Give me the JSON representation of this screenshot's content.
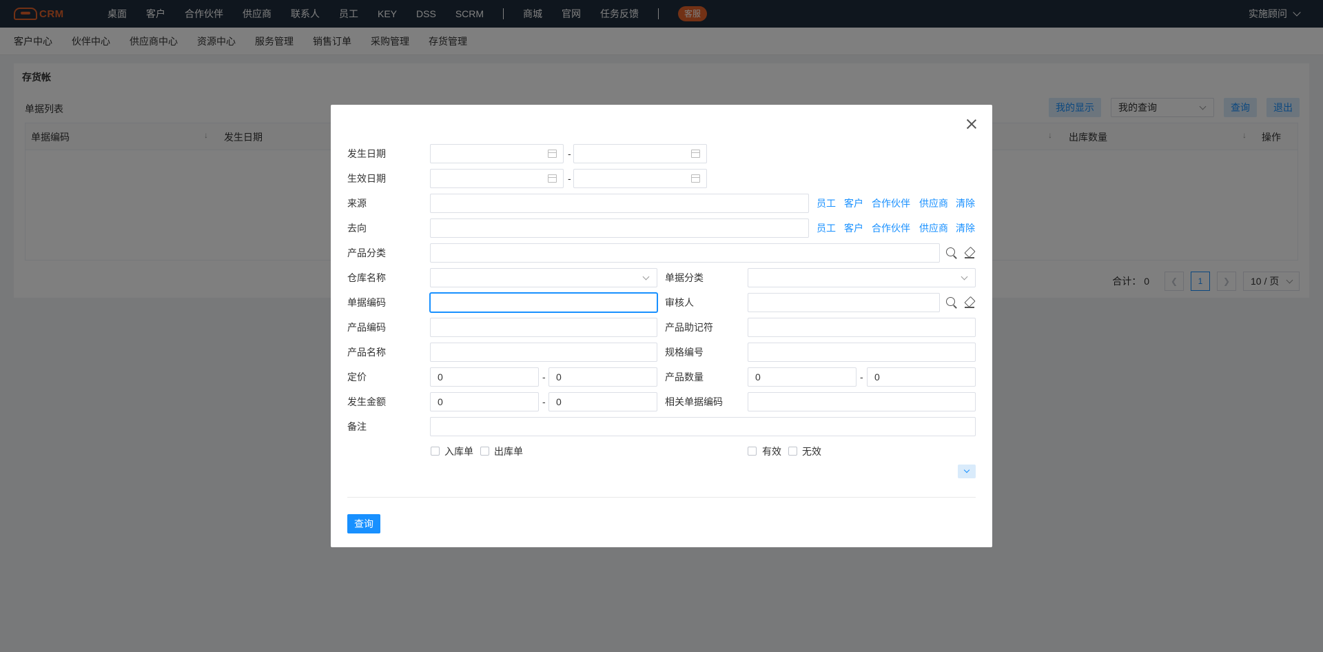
{
  "topnav": {
    "logo_text": "CRM",
    "items": [
      "桌面",
      "客户",
      "合作伙伴",
      "供应商",
      "联系人",
      "员工",
      "KEY",
      "DSS",
      "SCRM"
    ],
    "items2": [
      "商城",
      "官网",
      "任务反馈"
    ],
    "badge": "客服",
    "user": "实施顾问"
  },
  "subnav": {
    "items": [
      "客户中心",
      "伙伴中心",
      "供应商中心",
      "资源中心",
      "服务管理",
      "销售订单",
      "采购管理",
      "存货管理"
    ]
  },
  "page": {
    "title": "存货帐",
    "list_title": "单据列表",
    "btn_display": "我的显示",
    "select_query": "我的查询",
    "btn_query": "查询",
    "btn_exit": "退出",
    "columns": [
      "单据编码",
      "发生日期",
      "出库数量",
      "操作"
    ],
    "total_label": "合计：",
    "total_value": "0",
    "page_current": "1",
    "page_size": "10 / 页"
  },
  "modal": {
    "labels": {
      "occur_date": "发生日期",
      "effective_date": "生效日期",
      "source": "来源",
      "destination": "去向",
      "product_category": "产品分类",
      "warehouse": "仓库名称",
      "doc_category": "单据分类",
      "doc_code": "单据编码",
      "reviewer": "审核人",
      "product_code": "产品编码",
      "product_mnemonic": "产品助记符",
      "product_name": "产品名称",
      "spec_code": "规格编号",
      "price": "定价",
      "product_qty": "产品数量",
      "amount": "发生金额",
      "related_doc_code": "相关单据编码",
      "remark": "备注"
    },
    "range_dash": "-",
    "pick_links": [
      "员工",
      "客户",
      "合作伙伴",
      "供应商",
      "清除"
    ],
    "values": {
      "price_from": "0",
      "price_to": "0",
      "qty_from": "0",
      "qty_to": "0",
      "amount_from": "0",
      "amount_to": "0"
    },
    "checkboxes": {
      "in_doc": "入库单",
      "out_doc": "出库单",
      "valid": "有效",
      "invalid": "无效"
    },
    "submit": "查询"
  }
}
